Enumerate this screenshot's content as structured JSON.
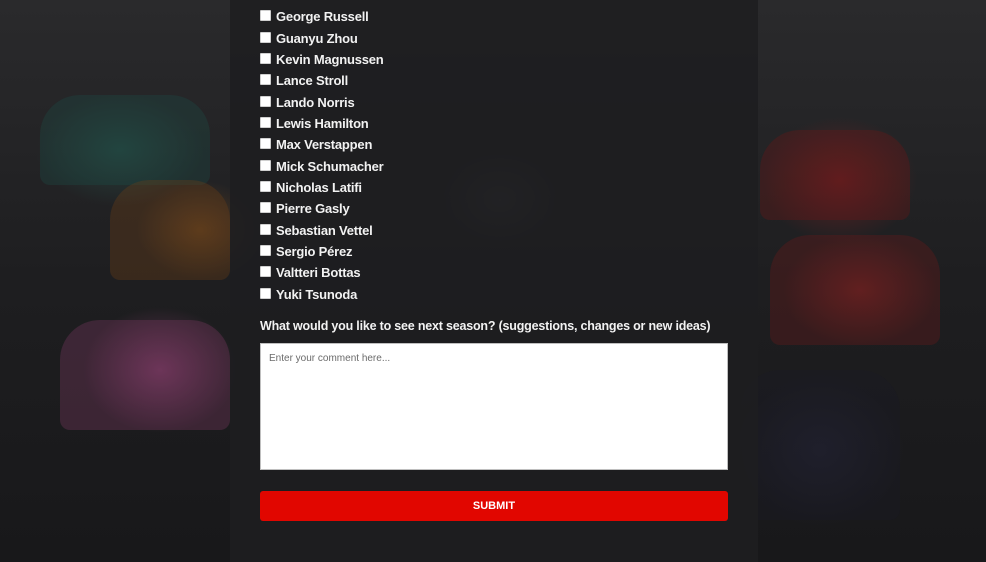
{
  "drivers": [
    {
      "name": "George Russell",
      "checked": false
    },
    {
      "name": "Guanyu Zhou",
      "checked": false
    },
    {
      "name": "Kevin Magnussen",
      "checked": false
    },
    {
      "name": "Lance Stroll",
      "checked": false
    },
    {
      "name": "Lando Norris",
      "checked": false
    },
    {
      "name": "Lewis Hamilton",
      "checked": false
    },
    {
      "name": "Max Verstappen",
      "checked": false
    },
    {
      "name": "Mick Schumacher",
      "checked": false
    },
    {
      "name": "Nicholas Latifi",
      "checked": false
    },
    {
      "name": "Pierre Gasly",
      "checked": false
    },
    {
      "name": "Sebastian Vettel",
      "checked": false
    },
    {
      "name": "Sergio Pérez",
      "checked": false
    },
    {
      "name": "Valtteri Bottas",
      "checked": false
    },
    {
      "name": "Yuki Tsunoda",
      "checked": false
    }
  ],
  "feedback": {
    "question": "What would you like to see next season? (suggestions, changes or new ideas)",
    "placeholder": "Enter your comment here...",
    "value": ""
  },
  "submit_label": "SUBMIT",
  "colors": {
    "accent": "#e10600",
    "panel": "#1e1e20",
    "text": "#f2f2f2"
  }
}
